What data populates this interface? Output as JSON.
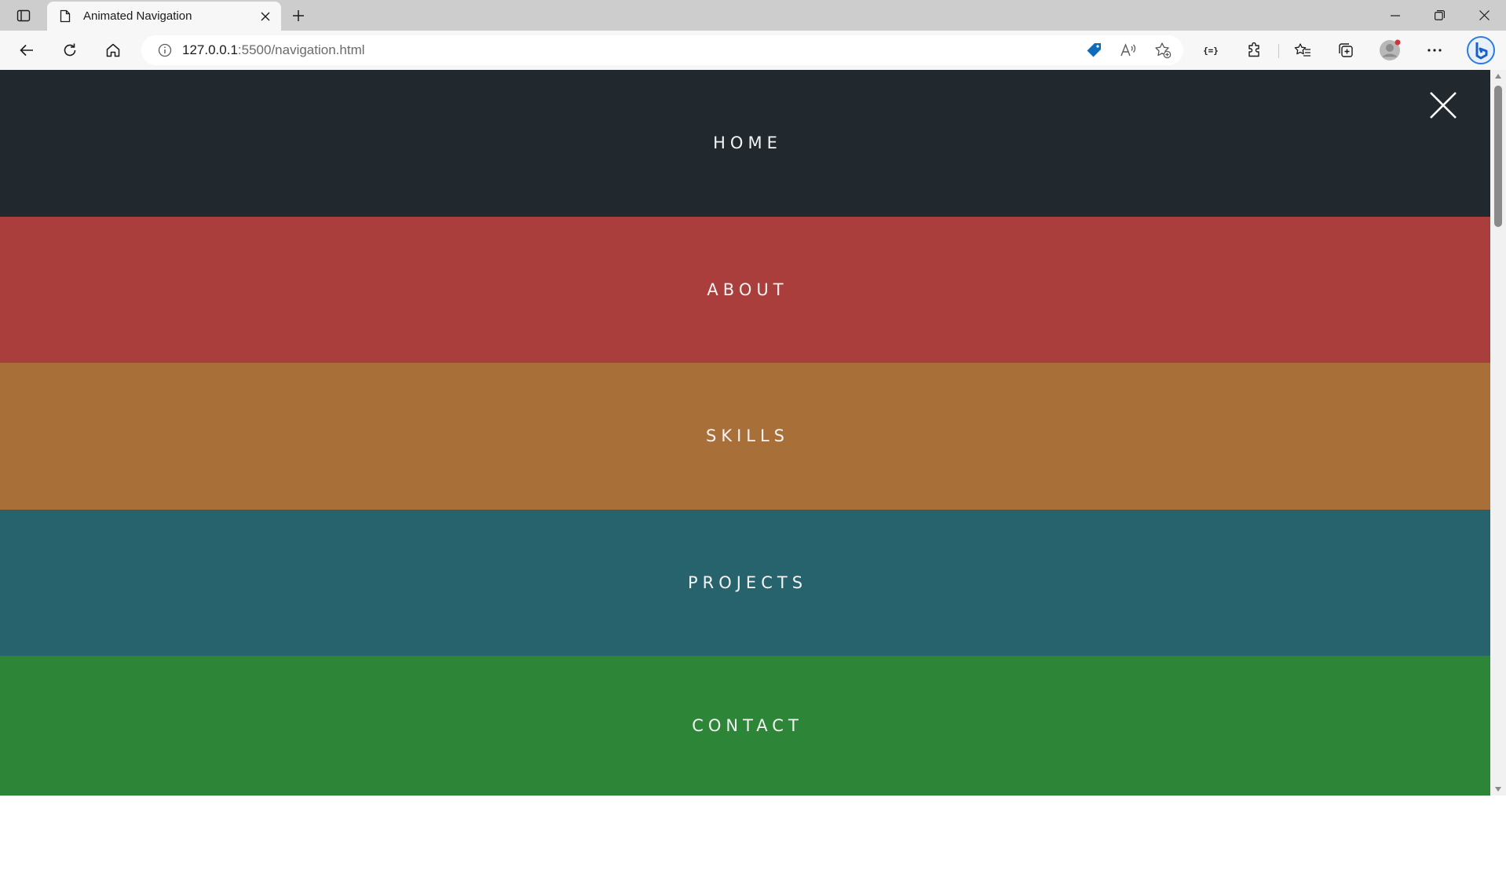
{
  "browser": {
    "tab": {
      "title": "Animated Navigation"
    },
    "address": {
      "host": "127.0.0.1",
      "path": ":5500/navigation.html"
    },
    "icons": {
      "tab_actions": "tab-actions-icon",
      "page": "page-icon",
      "tab_close": "close-icon",
      "new_tab": "plus-icon",
      "back": "back-arrow-icon",
      "refresh": "refresh-icon",
      "home": "home-icon",
      "info": "info-icon",
      "coupon": "tag-icon",
      "read_aloud": "read-aloud-icon",
      "favorite_add": "star-add-icon",
      "dev": "braces-icon",
      "extensions": "puzzle-icon",
      "favorites": "favorites-icon",
      "collections": "collections-icon",
      "profile": "avatar-icon",
      "more": "more-icon",
      "copilot": "bing-icon"
    }
  },
  "nav": {
    "items": [
      {
        "label": "HOME",
        "color": "#21292e"
      },
      {
        "label": "ABOUT",
        "color": "#aa3e3c"
      },
      {
        "label": "SKILLS",
        "color": "#a86f39"
      },
      {
        "label": "PROJECTS",
        "color": "#26636c"
      },
      {
        "label": "CONTACT",
        "color": "#2d8637"
      }
    ],
    "close_icon": "close-icon"
  },
  "colors": {
    "chrome_tabbar": "#cdcdcd",
    "chrome_toolbar": "#f7f7f7",
    "accent_blue": "#0f6cbd"
  }
}
